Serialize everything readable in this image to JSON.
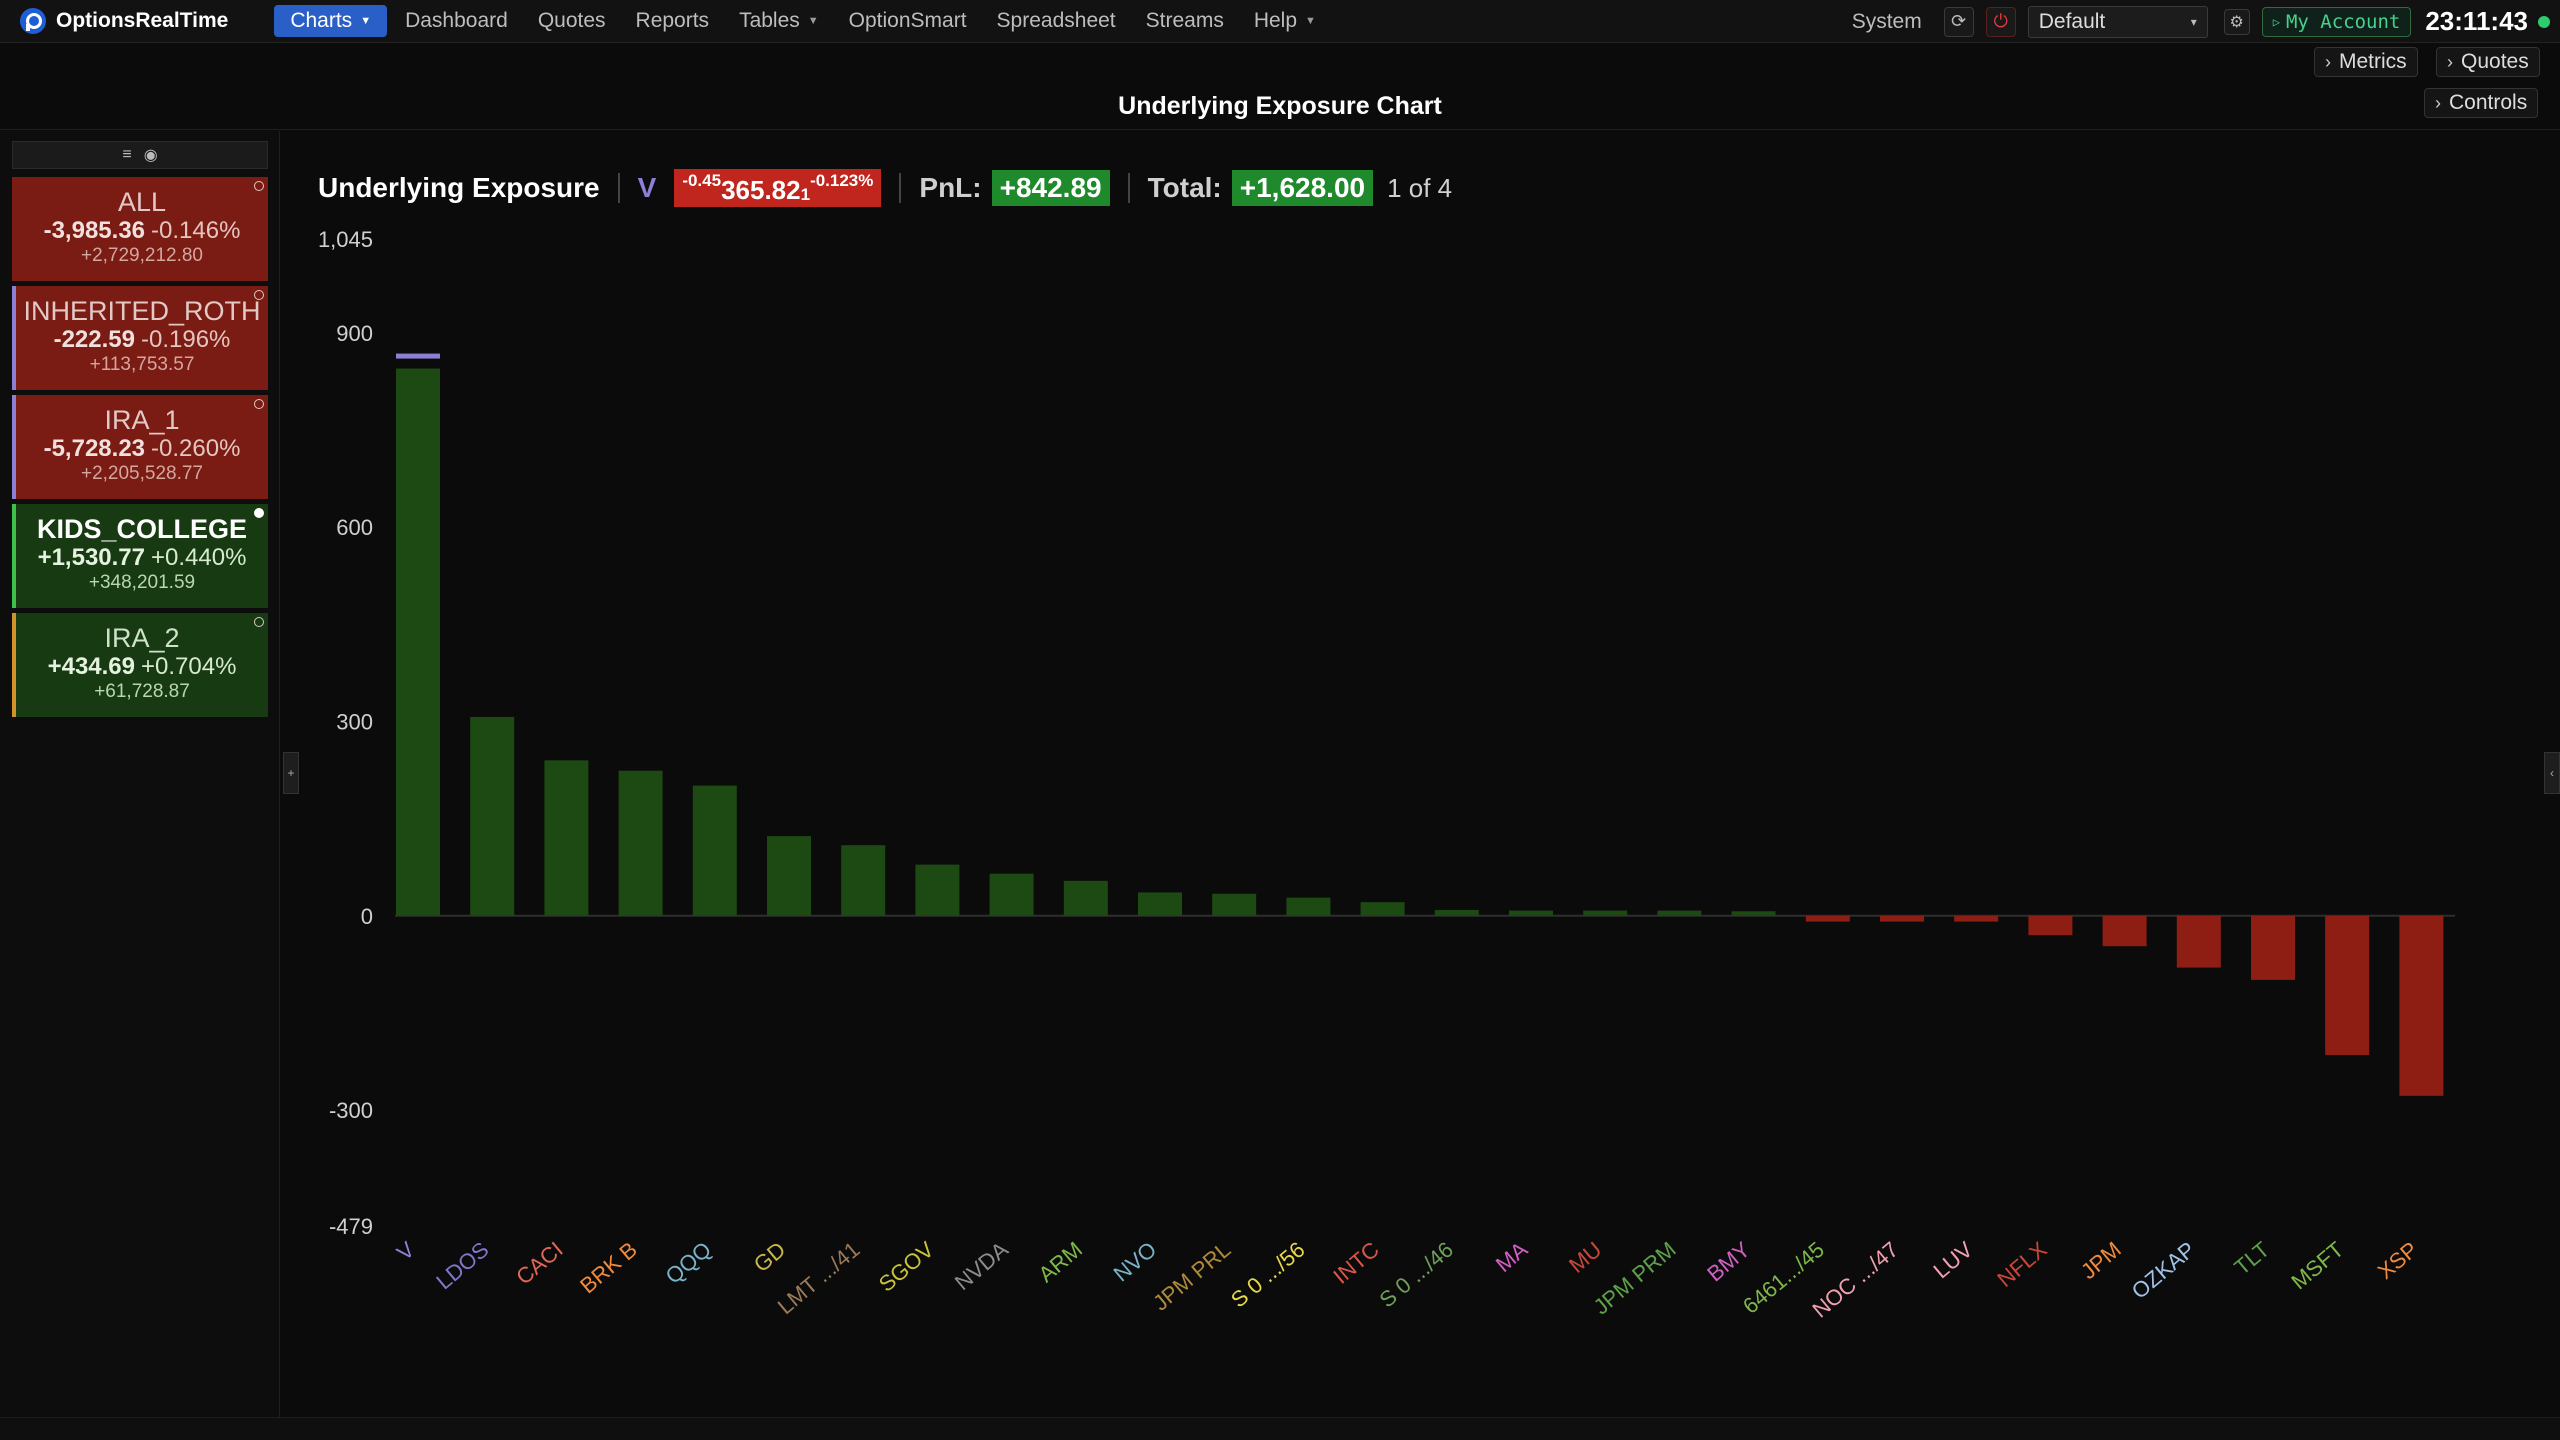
{
  "app": {
    "name": "OptionsRealTime"
  },
  "nav": [
    {
      "label": "Charts",
      "active": true,
      "caret": true
    },
    {
      "label": "Dashboard"
    },
    {
      "label": "Quotes"
    },
    {
      "label": "Reports"
    },
    {
      "label": "Tables",
      "caret": true
    },
    {
      "label": "OptionSmart"
    },
    {
      "label": "Spreadsheet"
    },
    {
      "label": "Streams"
    },
    {
      "label": "Help",
      "caret": true
    }
  ],
  "system": {
    "label": "System",
    "profile": "Default",
    "account_label": "My Account",
    "clock": "23:11:43",
    "status_color": "#2ecc71"
  },
  "panels": {
    "metrics": "Metrics",
    "quotes": "Quotes",
    "controls": "Controls"
  },
  "page_title": "Underlying Exposure Chart",
  "accounts": [
    {
      "name": "ALL",
      "pnl": "-3,985.36",
      "pct": "-0.146%",
      "balance": "+2,729,212.80",
      "tone": "red",
      "selected": false
    },
    {
      "name": "INHERITED_ROTH",
      "pnl": "-222.59",
      "pct": "-0.196%",
      "balance": "+113,753.57",
      "tone": "red",
      "selected": false
    },
    {
      "name": "IRA_1",
      "pnl": "-5,728.23",
      "pct": "-0.260%",
      "balance": "+2,205,528.77",
      "tone": "red",
      "selected": false
    },
    {
      "name": "KIDS_COLLEGE",
      "pnl": "+1,530.77",
      "pct": "+0.440%",
      "balance": "+348,201.59",
      "tone": "green",
      "selected": true
    },
    {
      "name": "IRA_2",
      "pnl": "+434.69",
      "pct": "+0.704%",
      "balance": "+61,728.87",
      "tone": "green",
      "selected": false
    }
  ],
  "chart_header": {
    "title": "Underlying Exposure",
    "symbol": "V",
    "quote_change": "-0.45",
    "quote_price": "365.82",
    "quote_sub": "1",
    "quote_pct": "-0.123%",
    "pnl_label": "PnL:",
    "pnl_value": "+842.89",
    "total_label": "Total:",
    "total_value": "+1,628.00",
    "page": "1 of 4"
  },
  "chart_data": {
    "type": "bar",
    "ylim": [
      -479,
      1045
    ],
    "yticks": [
      1045,
      900,
      600,
      300,
      0,
      -300,
      -479
    ],
    "categories": [
      "V",
      "LDOS",
      "CACI",
      "BRK B",
      "QQQ",
      "GD",
      "LMT .../41",
      "SGOV",
      "NVDA",
      "ARM",
      "NVO",
      "JPM PRL",
      "S 0 .../56",
      "INTC",
      "S 0 .../46",
      "MA",
      "MU",
      "JPM PRM",
      "BMY",
      "6461.../45",
      "NOC .../47",
      "LUV",
      "NFLX",
      "JPM",
      "OZKAP",
      "TLT",
      "MSFT",
      "XSP"
    ],
    "values": [
      845,
      307,
      240,
      224,
      201,
      123,
      109,
      79,
      65,
      54,
      36,
      34,
      28,
      21,
      9,
      8,
      8,
      8,
      7,
      -9,
      -9,
      -9,
      -30,
      -47,
      -80,
      -99,
      -215,
      -278
    ],
    "label_colors": [
      "#8c7fd6",
      "#7f77c9",
      "#e0675a",
      "#f08a3c",
      "#79b3c7",
      "#c9b847",
      "#9a7a5a",
      "#c9c23a",
      "#8c8c8c",
      "#7fb84a",
      "#79b3c7",
      "#b08a3a",
      "#e8d84a",
      "#d9574a",
      "#6fa05a",
      "#d15fc4",
      "#c9473a",
      "#5fa04a",
      "#d15fc4",
      "#7fb84a",
      "#f0a0b0",
      "#f0a0b0",
      "#c9473a",
      "#f08a3c",
      "#9fc3e8",
      "#5fa04a",
      "#7fb84a",
      "#f08a3c"
    ],
    "pos_color": "#1d4a13",
    "neg_color": "#8e1e14",
    "marker": {
      "category": "V",
      "value": 865,
      "color": "#8c7fd6"
    }
  }
}
